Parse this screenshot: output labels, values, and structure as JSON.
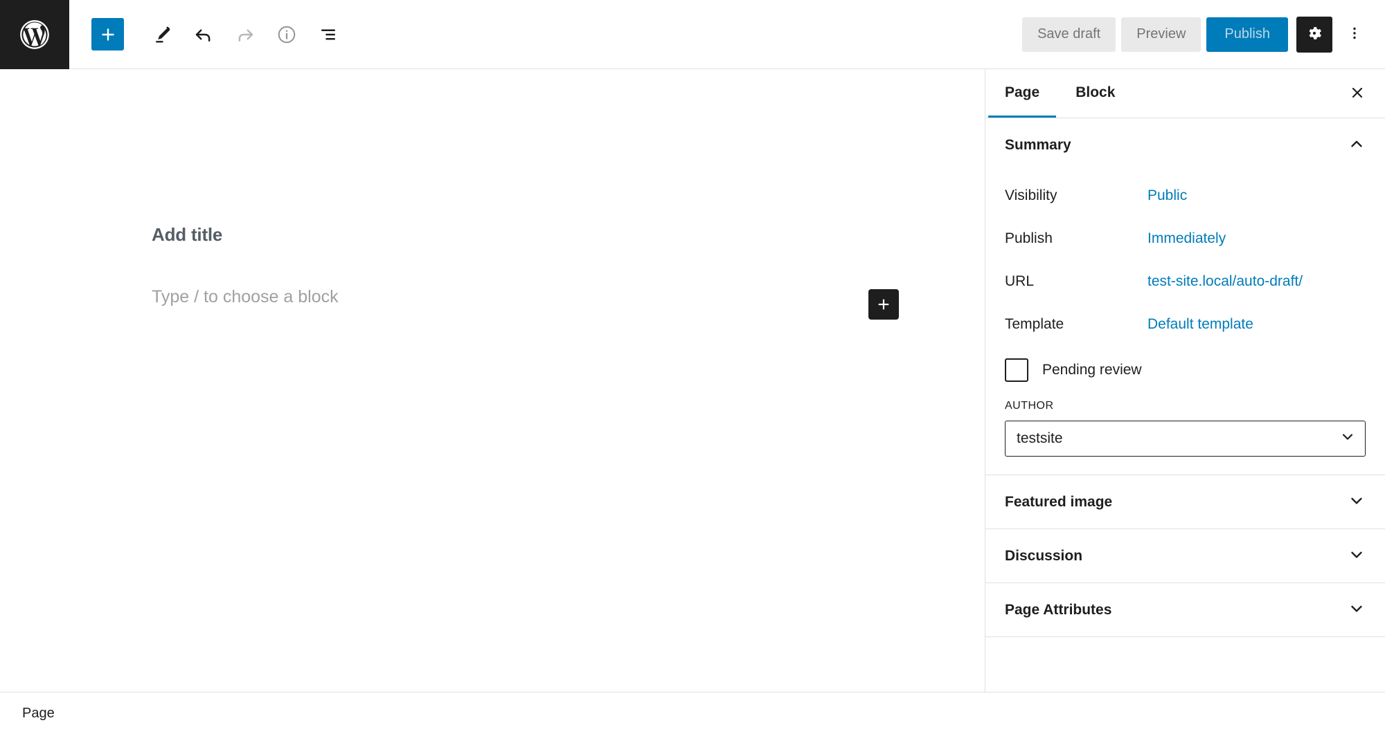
{
  "app": {
    "name": "WordPress Block Editor",
    "logo_icon": "wordpress-logo-icon"
  },
  "toolbar": {
    "add_block_label": "+",
    "add_block_icon": "plus-icon",
    "tools_icon": "pencil-icon",
    "undo_icon": "undo-arrow-icon",
    "redo_icon": "redo-arrow-icon",
    "details_icon": "info-circle-icon",
    "list_view_icon": "list-view-icon",
    "save_draft_label": "Save draft",
    "preview_label": "Preview",
    "publish_label": "Publish",
    "settings_icon": "gear-icon",
    "options_icon": "kebab-menu-icon"
  },
  "editor": {
    "title_placeholder": "Add title",
    "block_placeholder": "Type / to choose a block",
    "inline_inserter_icon": "plus-icon"
  },
  "sidebar": {
    "tabs": [
      {
        "label": "Page",
        "active": true
      },
      {
        "label": "Block",
        "active": false
      }
    ],
    "close_icon": "close-icon",
    "panels": [
      {
        "title": "Summary",
        "expanded": true,
        "chevron_icon": "chevron-up-icon"
      },
      {
        "title": "Featured image",
        "expanded": false,
        "chevron_icon": "chevron-down-icon"
      },
      {
        "title": "Discussion",
        "expanded": false,
        "chevron_icon": "chevron-down-icon"
      },
      {
        "title": "Page Attributes",
        "expanded": false,
        "chevron_icon": "chevron-down-icon"
      }
    ],
    "summary": {
      "rows": [
        {
          "label": "Visibility",
          "value": "Public"
        },
        {
          "label": "Publish",
          "value": "Immediately"
        },
        {
          "label": "URL",
          "value": "test-site.local/auto-draft/"
        },
        {
          "label": "Template",
          "value": "Default template"
        }
      ],
      "pending_review": {
        "label": "Pending review",
        "checked": false
      },
      "author": {
        "label": "AUTHOR",
        "value": "testsite",
        "chevron_icon": "chevron-down-icon"
      }
    }
  },
  "bottombar": {
    "breadcrumb": "Page"
  },
  "colors": {
    "accent_blue": "#007cba",
    "dark": "#1e1e1e",
    "border": "#e0e0e0",
    "muted_text": "#757575",
    "placeholder_text": "#a0a0a0"
  }
}
